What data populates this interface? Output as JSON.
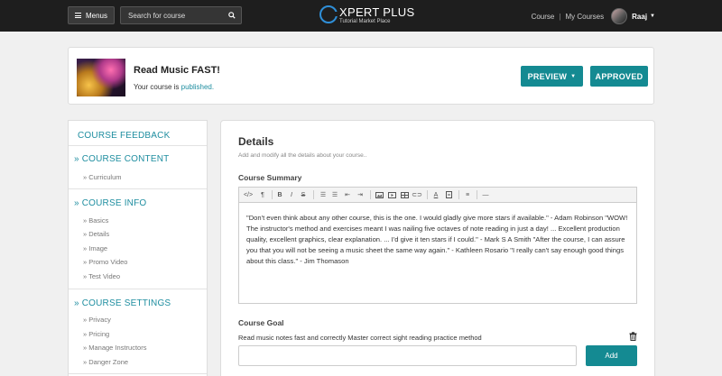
{
  "topbar": {
    "menus_label": "Menus",
    "search_placeholder": "Search for course",
    "logo_title": "XPERT PLUS",
    "logo_subtitle": "Tutorial Market Place",
    "links": [
      "Course",
      "My Courses"
    ],
    "user_name": "Raaj"
  },
  "header": {
    "course_title": "Read Music FAST!",
    "status_prefix": "Your course is ",
    "status_value": "published.",
    "preview_label": "PREVIEW",
    "approved_label": "APPROVED"
  },
  "sidebar": {
    "feedback": "COURSE FEEDBACK",
    "sections": [
      {
        "title": "» COURSE CONTENT",
        "items": [
          "» Curriculum"
        ]
      },
      {
        "title": "» COURSE INFO",
        "items": [
          "» Basics",
          "» Details",
          "» Image",
          "» Promo Video",
          "» Test Video"
        ]
      },
      {
        "title": "» COURSE SETTINGS",
        "items": [
          "» Privacy",
          "» Pricing",
          "» Manage Instructors",
          "» Danger Zone"
        ]
      }
    ]
  },
  "main": {
    "title": "Details",
    "description": "Add and modify all the details about your course..",
    "summary_label": "Course Summary",
    "summary_text": "\"Don't even think about any other course, this is the one. I would gladly give more stars if available.\" - Adam Robinson \"WOW! The instructor's method and exercises meant I was nailing five octaves of note reading in just a day! ... Excellent production quality, excellent graphics, clear explanation. ... I'd give it ten stars if I could.\" - Mark S A Smith \"After the course, I can assure you that you will not be seeing a music sheet the same way again.\" - Kathleen Rosario \"I really can't say enough good things about this class.\" - Jim Thomason",
    "toolbar": [
      "</>",
      "¶",
      "B",
      "I",
      "S",
      "ul",
      "ol",
      "outdent",
      "indent",
      "image",
      "video",
      "table",
      "link",
      "A",
      "highlight",
      "align",
      "hr"
    ],
    "goal_label": "Course Goal",
    "goal_item": "Read music notes fast and correctly Master correct sight reading practice method",
    "goal_input_value": "",
    "add_label": "Add"
  },
  "colors": {
    "accent": "#148a92",
    "link": "#1f8ea0",
    "topbar": "#1e1e1e"
  }
}
